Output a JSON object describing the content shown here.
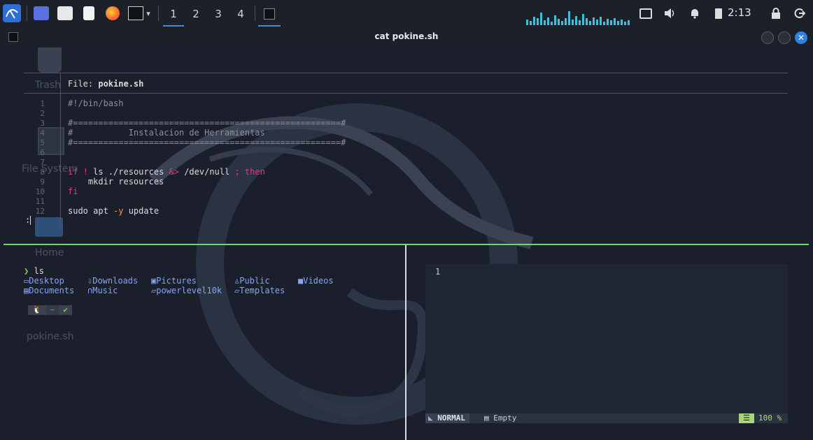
{
  "taskbar": {
    "workspaces": [
      "1",
      "2",
      "3",
      "4"
    ],
    "clock": "2:13",
    "icons": [
      "kali-menu-icon",
      "show-desktop-icon",
      "file-manager-icon",
      "text-editor-icon",
      "firefox-icon",
      "terminal-icon",
      "network-icon",
      "volume-icon",
      "notification-bell-icon",
      "battery-icon",
      "lock-icon",
      "logout-icon"
    ]
  },
  "window": {
    "title": "cat pokine.sh"
  },
  "desktop": {
    "labels": [
      "Trash",
      "File System",
      "Home",
      "pokine.sh"
    ]
  },
  "bat": {
    "file_label": "File:",
    "file_name": "pokine.sh",
    "line_numbers": [
      "1",
      "2",
      "3",
      "4",
      "5",
      "6",
      "7",
      "8",
      "9",
      "10",
      "11",
      "12"
    ],
    "lines": [
      "#!/bin/bash",
      "",
      "#=====================================================#",
      "#           Instalacion de Herramientas",
      "#=====================================================#",
      "",
      "",
      "if ! ls ./resources &> /dev/null ; then",
      "    mkdir resources",
      "fi",
      "",
      "sudo apt -y update"
    ],
    "pager_prompt": ":"
  },
  "shell": {
    "prompt_symbol": "❯",
    "command": "ls",
    "ls_output": [
      [
        "Desktop",
        "Downloads",
        "Pictures",
        "Public",
        "Videos"
      ],
      [
        "Documents",
        "Music",
        "powerlevel10k",
        "Templates"
      ]
    ],
    "p10k_segments": [
      "🐧",
      "~",
      "✔"
    ]
  },
  "vim": {
    "line_number": "1",
    "mode": "NORMAL",
    "buffer": "Empty",
    "percent": "100 %"
  },
  "colors": {
    "accent": "#3b8fe6",
    "split_active": "#6ddc5a",
    "dir": "#83a6f2",
    "keyword": "#f0337e"
  }
}
